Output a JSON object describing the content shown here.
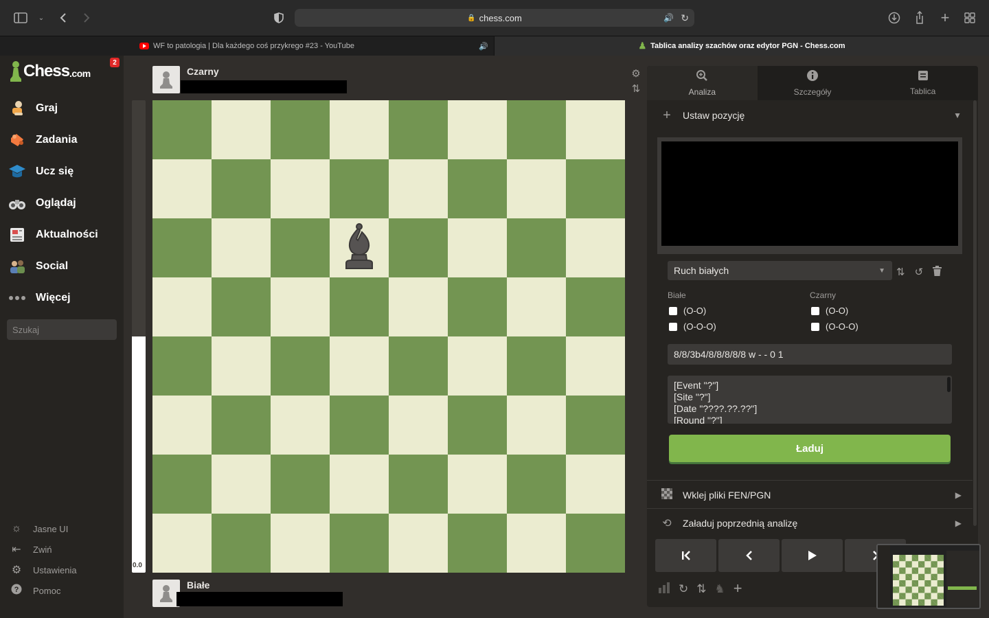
{
  "browser": {
    "url": "chess.com",
    "tabs": [
      {
        "title": "WF to patologia | Dla każdego coś przykrego #23 - YouTube"
      },
      {
        "title": "Tablica analizy szachów oraz edytor PGN - Chess.com"
      }
    ]
  },
  "sidebar": {
    "logo_text": "Chess",
    "logo_suffix": ".com",
    "badge": "2",
    "items": [
      {
        "label": "Graj",
        "icon": "pawn-hand-icon"
      },
      {
        "label": "Zadania",
        "icon": "puzzle-icon"
      },
      {
        "label": "Ucz się",
        "icon": "graduation-cap-icon"
      },
      {
        "label": "Oglądaj",
        "icon": "binoculars-icon"
      },
      {
        "label": "Aktualności",
        "icon": "newspaper-icon"
      },
      {
        "label": "Social",
        "icon": "people-icon"
      },
      {
        "label": "Więcej",
        "icon": "dots-icon"
      }
    ],
    "search_placeholder": "Szukaj",
    "bottom": [
      {
        "label": "Jasne UI",
        "icon": "sun-icon"
      },
      {
        "label": "Zwiń",
        "icon": "collapse-icon"
      },
      {
        "label": "Ustawienia",
        "icon": "gear-icon"
      },
      {
        "label": "Pomoc",
        "icon": "help-icon"
      }
    ]
  },
  "board": {
    "top_player": "Czarny",
    "bottom_player": "Białe",
    "eval": "0.0",
    "eval_white_fraction": 0.5,
    "colors": {
      "light": "#ebecd0",
      "dark": "#739552"
    },
    "pieces": [
      {
        "square": "d6",
        "piece": "black-bishop"
      }
    ]
  },
  "panel": {
    "tabs": [
      {
        "label": "Analiza",
        "icon": "magnifier-icon"
      },
      {
        "label": "Szczegóły",
        "icon": "info-icon"
      },
      {
        "label": "Tablica",
        "icon": "board-icon"
      }
    ],
    "setup_title": "Ustaw pozycję",
    "side_to_move": "Ruch białych",
    "white_label": "Białe",
    "black_label": "Czarny",
    "castling_short": "(O-O)",
    "castling_long": "(O-O-O)",
    "fen": "8/8/3b4/8/8/8/8/8 w - - 0 1",
    "pgn_lines": [
      "[Event \"?\"]",
      "[Site \"?\"]",
      "[Date \"????.??.??\"]",
      "[Round \"?\"]"
    ],
    "load_button": "Ładuj",
    "paste_label": "Wklej pliki FEN/PGN",
    "previous_label": "Załaduj poprzednią analizę"
  }
}
